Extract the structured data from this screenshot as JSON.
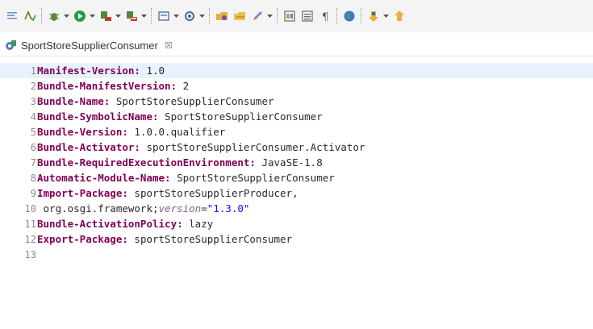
{
  "tab": {
    "title": "SportStoreSupplierConsumer",
    "close_glyph": "☒"
  },
  "editor": {
    "lines": [
      {
        "num": "1",
        "key": "Manifest-Version:",
        "value": " 1.0"
      },
      {
        "num": "2",
        "key": "Bundle-ManifestVersion:",
        "value": " 2"
      },
      {
        "num": "3",
        "key": "Bundle-Name:",
        "value": " SportStoreSupplierConsumer"
      },
      {
        "num": "4",
        "key": "Bundle-SymbolicName:",
        "value": " SportStoreSupplierConsumer"
      },
      {
        "num": "5",
        "key": "Bundle-Version:",
        "value": " 1.0.0.qualifier"
      },
      {
        "num": "6",
        "key": "Bundle-Activator:",
        "value": " sportStoreSupplierConsumer.Activator"
      },
      {
        "num": "7",
        "key": "Bundle-RequiredExecutionEnvironment:",
        "value": " JavaSE-1.8"
      },
      {
        "num": "8",
        "key": "Automatic-Module-Name:",
        "value": " SportStoreSupplierConsumer"
      },
      {
        "num": "9",
        "key": "Import-Package:",
        "value": " sportStoreSupplierProducer,"
      },
      {
        "num": "10",
        "continuation": " org.osgi.framework;",
        "attr": "version",
        "eq": "=",
        "str": "\"1.3.0\""
      },
      {
        "num": "11",
        "key": "Bundle-ActivationPolicy:",
        "value": " lazy"
      },
      {
        "num": "12",
        "key": "Export-Package:",
        "value": " sportStoreSupplierConsumer"
      },
      {
        "num": "13"
      }
    ]
  },
  "toolbar_icons": [
    "format-icon",
    "spell-icon",
    "debug-icon",
    "run-icon",
    "run-external-icon",
    "coverage-icon",
    "new-server-icon",
    "new-plugin-icon",
    "open-folder-icon",
    "open-folder-2-icon",
    "pen-icon",
    "compare-icon",
    "toggle-view-icon",
    "pilcrow-icon",
    "globe-icon",
    "next-annotation-icon",
    "prev-annotation-icon"
  ],
  "colors": {
    "header_key": "#7f0055",
    "current_line": "#e8f2fe",
    "string": "#2a00ff",
    "attribute": "#7f5f9f"
  }
}
